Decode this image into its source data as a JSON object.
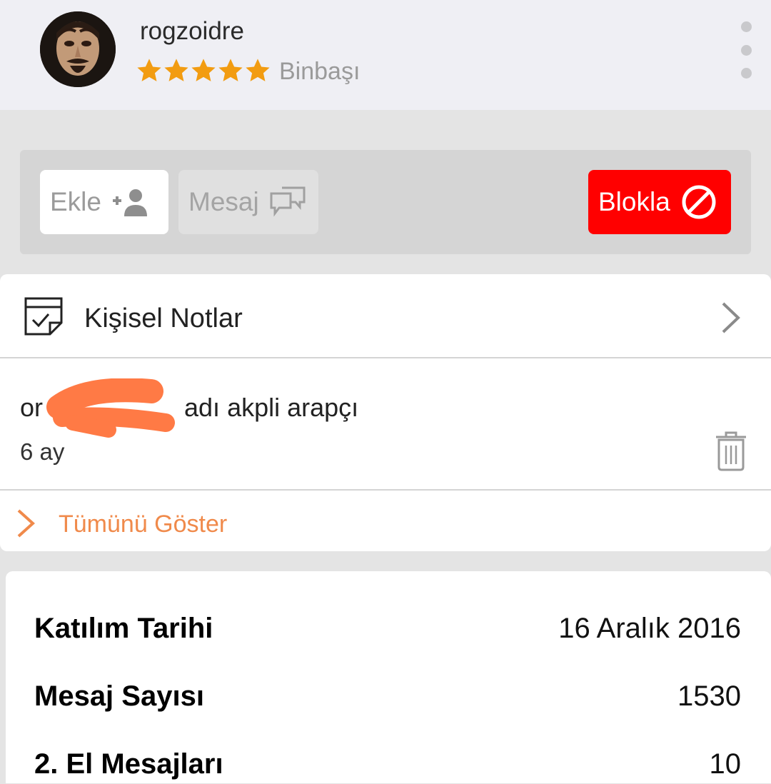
{
  "profile": {
    "username": "rogzoidre",
    "rank": "Binbaşı",
    "stars": 5,
    "star_color": "#f29c11"
  },
  "actions": {
    "add_label": "Ekle",
    "message_label": "Mesaj",
    "block_label": "Blokla",
    "block_color": "#ff0000"
  },
  "notes": {
    "title": "Kişisel Notlar",
    "items": [
      {
        "text_visible_start": "or",
        "text_visible_end": "adı akpli arapçı",
        "age": "6 ay"
      }
    ],
    "show_all_label": "Tümünü Göster",
    "accent_color": "#f08a4b"
  },
  "stats": [
    {
      "label": "Katılım Tarihi",
      "value": "16 Aralık 2016"
    },
    {
      "label": "Mesaj Sayısı",
      "value": "1530"
    },
    {
      "label": "2. El Mesajları",
      "value": "10"
    }
  ]
}
